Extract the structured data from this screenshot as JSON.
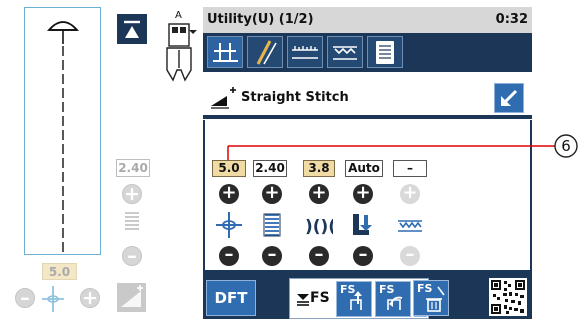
{
  "header": {
    "title": "Utility(U) (1/2)",
    "time": "0:32"
  },
  "pattern": {
    "name": "Straight Stitch"
  },
  "settings": {
    "values": [
      "5.0",
      "2.40",
      "3.8",
      "Auto",
      "–"
    ]
  },
  "preview": {
    "width_value": "2.40",
    "length_value": "5.0",
    "foot_label": "A"
  },
  "callout": {
    "number": "6"
  },
  "buttons": {
    "dft": "DFT",
    "fs_main": "FS",
    "fs_save": "FS",
    "fs_recall": "FS",
    "fs_delete": "FS"
  },
  "colors": {
    "dark_navy": "#1c3657",
    "blue": "#2f6cb0",
    "highlight": "#f1dba5",
    "preview_border": "#6fb0d6",
    "callout_line": "#e00000"
  },
  "icons": {
    "tabs": [
      "straight-stitch-tab-icon",
      "needle-tab-icon",
      "satin-tab-icon",
      "decorative-tab-icon",
      "memory-tab-icon"
    ],
    "rows": [
      "needle-position-icon",
      "stitch-length-icon",
      "tension-icon",
      "presser-pressure-icon",
      "feed-dog-icon"
    ]
  }
}
